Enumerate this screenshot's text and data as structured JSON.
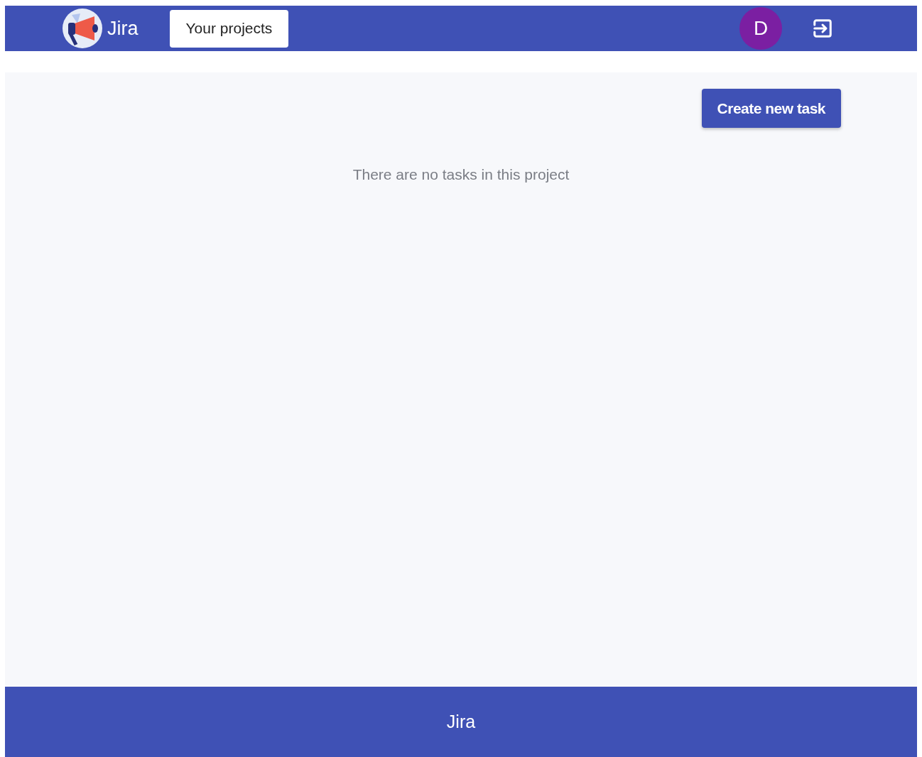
{
  "header": {
    "brand": "Jira",
    "nav_button": "Your projects",
    "avatar_initial": "D"
  },
  "main": {
    "action_button": "Create new task",
    "empty_message": "There are no tasks in this project"
  },
  "footer": {
    "text": "Jira"
  }
}
